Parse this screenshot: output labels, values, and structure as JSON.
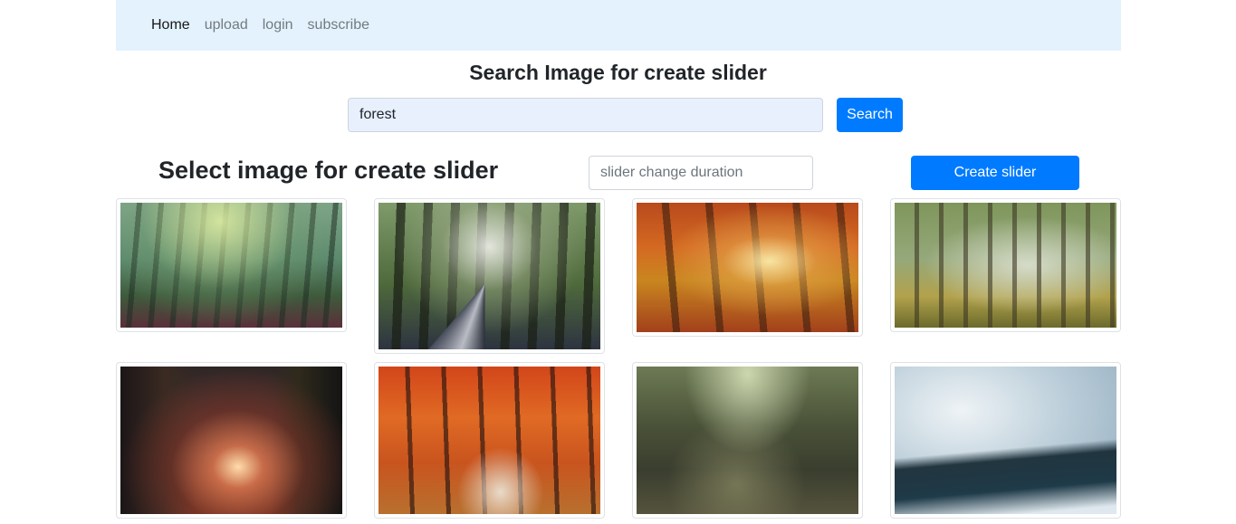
{
  "nav": {
    "items": [
      "Home",
      "upload",
      "login",
      "subscribe"
    ],
    "active": "Home"
  },
  "search": {
    "title": "Search Image for create slider",
    "value": "forest",
    "button_label": "Search"
  },
  "select": {
    "title": "Select image for create slider",
    "duration_placeholder": "slider change duration",
    "create_label": "Create slider"
  },
  "gallery": {
    "images": [
      {
        "subject": "misty green forest"
      },
      {
        "subject": "forest road with sunbeams"
      },
      {
        "subject": "autumn forest path"
      },
      {
        "subject": "sunlit forest clearing"
      },
      {
        "subject": "dark forest with glowing light"
      },
      {
        "subject": "red autumn forest road"
      },
      {
        "subject": "mossy forest trail"
      },
      {
        "subject": "fog over pine forest"
      }
    ]
  },
  "colors": {
    "navbar_bg": "#e3f2fd",
    "primary": "#007bff",
    "input_autofill": "#e8f0fe"
  }
}
